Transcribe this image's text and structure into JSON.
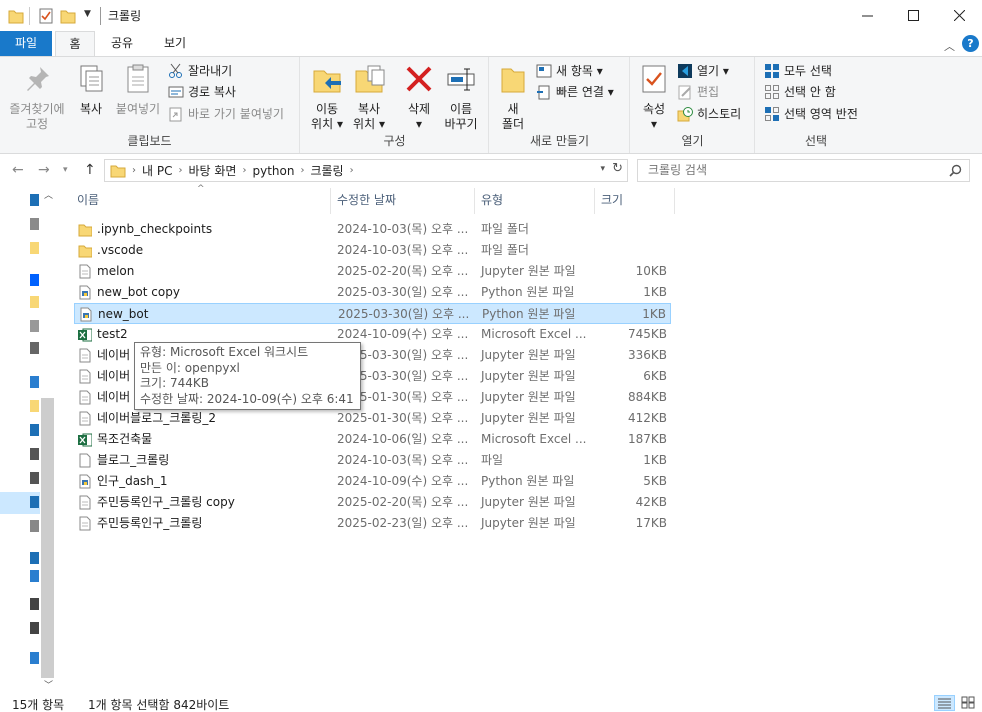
{
  "window": {
    "title": "크롤링",
    "controls": [
      "minimize",
      "maximize",
      "close"
    ]
  },
  "ribbon_tabs": [
    {
      "label": "파일",
      "kind": "file"
    },
    {
      "label": "홈",
      "kind": "active"
    },
    {
      "label": "공유",
      "kind": "normal"
    },
    {
      "label": "보기",
      "kind": "normal"
    }
  ],
  "ribbon": {
    "clipboard": {
      "group_label": "클립보드",
      "pin_label_1": "즐겨찾기에",
      "pin_label_2": "고정",
      "copy_label": "복사",
      "paste_label": "붙여넣기",
      "cut_label": "잘라내기",
      "copy_path_label": "경로 복사",
      "paste_shortcut_label": "바로 가기 붙여넣기"
    },
    "organize": {
      "group_label": "구성",
      "move_to_1": "이동",
      "move_to_2": "위치",
      "copy_to_1": "복사",
      "copy_to_2": "위치",
      "delete_label": "삭제",
      "rename_1": "이름",
      "rename_2": "바꾸기"
    },
    "new": {
      "group_label": "새로 만들기",
      "new_folder_1": "새",
      "new_folder_2": "폴더",
      "new_item_label": "새 항목",
      "easy_access_label": "빠른 연결"
    },
    "open": {
      "group_label": "열기",
      "properties_label": "속성",
      "open_label": "열기",
      "edit_label": "편집",
      "history_label": "히스토리"
    },
    "select": {
      "group_label": "선택",
      "select_all_label": "모두 선택",
      "select_none_label": "선택 안 함",
      "invert_label": "선택 영역 반전"
    }
  },
  "address": {
    "crumbs": [
      "내 PC",
      "바탕 화면",
      "python",
      "크롤링"
    ],
    "search_placeholder": "크롤링 검색"
  },
  "columns": {
    "name": "이름",
    "date": "수정한 날짜",
    "type": "유형",
    "size": "크기"
  },
  "files": [
    {
      "name": ".ipynb_checkpoints",
      "date": "2024-10-03(목) 오후 ...",
      "type": "파일 폴더",
      "size": "",
      "icon": "folder-icon",
      "selected": false
    },
    {
      "name": ".vscode",
      "date": "2024-10-03(목) 오후 ...",
      "type": "파일 폴더",
      "size": "",
      "icon": "folder-icon",
      "selected": false
    },
    {
      "name": "melon",
      "date": "2025-02-20(목) 오후 ...",
      "type": "Jupyter 원본 파일",
      "size": "10KB",
      "icon": "doc-icon",
      "selected": false
    },
    {
      "name": "new_bot copy",
      "date": "2025-03-30(일) 오후 ...",
      "type": "Python 원본 파일",
      "size": "1KB",
      "icon": "python-icon",
      "selected": false
    },
    {
      "name": "new_bot",
      "date": "2025-03-30(일) 오후 ...",
      "type": "Python 원본 파일",
      "size": "1KB",
      "icon": "python-icon",
      "selected": true
    },
    {
      "name": "test2",
      "date": "2024-10-09(수) 오후 ...",
      "type": "Microsoft Excel ...",
      "size": "745KB",
      "icon": "excel-icon",
      "selected": false
    },
    {
      "name": "네이버",
      "date": "2025-03-30(일) 오후 ...",
      "type": "Jupyter 원본 파일",
      "size": "336KB",
      "icon": "doc-icon",
      "selected": false
    },
    {
      "name": "네이버",
      "date": "2025-03-30(일) 오후 ...",
      "type": "Jupyter 원본 파일",
      "size": "6KB",
      "icon": "doc-icon",
      "selected": false
    },
    {
      "name": "네이버",
      "date": "2025-01-30(목) 오후 ...",
      "type": "Jupyter 원본 파일",
      "size": "884KB",
      "icon": "doc-icon",
      "selected": false
    },
    {
      "name": "네이버블로그_크롤링_2",
      "date": "2025-01-30(목) 오후 ...",
      "type": "Jupyter 원본 파일",
      "size": "412KB",
      "icon": "doc-icon",
      "selected": false
    },
    {
      "name": "목조건축물",
      "date": "2024-10-06(일) 오후 ...",
      "type": "Microsoft Excel ...",
      "size": "187KB",
      "icon": "excel-icon",
      "selected": false
    },
    {
      "name": "블로그_크롤링",
      "date": "2024-10-03(목) 오후 ...",
      "type": "파일",
      "size": "1KB",
      "icon": "blank-file-icon",
      "selected": false
    },
    {
      "name": "인구_dash_1",
      "date": "2024-10-09(수) 오후 ...",
      "type": "Python 원본 파일",
      "size": "5KB",
      "icon": "python-icon",
      "selected": false
    },
    {
      "name": "주민등록인구_크롤링 copy",
      "date": "2025-02-20(목) 오후 ...",
      "type": "Jupyter 원본 파일",
      "size": "42KB",
      "icon": "doc-icon",
      "selected": false
    },
    {
      "name": "주민등록인구_크롤링",
      "date": "2025-02-23(일) 오후 ...",
      "type": "Jupyter 원본 파일",
      "size": "17KB",
      "icon": "doc-icon",
      "selected": false
    }
  ],
  "tooltip": {
    "line1": "유형: Microsoft Excel 워크시트",
    "line2": "만든 이: openpyxl",
    "line3": "크기: 744KB",
    "line4": "수정한 날짜: 2024-10-09(수) 오후 6:41"
  },
  "status": {
    "item_count": "15개 항목",
    "selection": "1개 항목 선택함 842바이트"
  },
  "colors": {
    "accent": "#1979ca",
    "selection_bg": "#cce8ff",
    "selection_border": "#99d1ff",
    "folder": "#f8d775",
    "excel": "#1d6f42"
  }
}
